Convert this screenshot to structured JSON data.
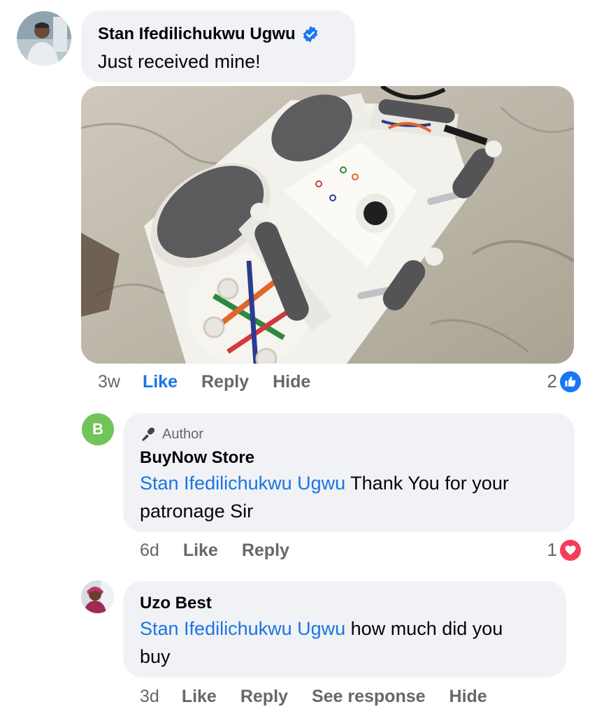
{
  "comments": [
    {
      "author": "Stan Ifedilichukwu Ugwu",
      "verified": true,
      "text": "Just received mine!",
      "has_photo": true,
      "time": "3w",
      "actions": [
        "Like",
        "Reply",
        "Hide"
      ],
      "liked": true,
      "reaction_count": "2",
      "reaction_type": "like",
      "reaction_color": "#1877f2"
    }
  ],
  "replies": [
    {
      "badge": "Author",
      "author": "BuyNow Store",
      "avatar_letter": "B",
      "avatar_color": "#71c45a",
      "mention": "Stan Ifedilichukwu Ugwu",
      "text_line1": " Thank You for your",
      "text_line2": "patronage Sir",
      "time": "6d",
      "actions": [
        "Like",
        "Reply"
      ],
      "reaction_count": "1",
      "reaction_type": "love",
      "reaction_color": "#f33e58"
    },
    {
      "author": "Uzo Best",
      "mention": "Stan Ifedilichukwu Ugwu",
      "text_line1": " how much did you",
      "text_line2": "buy",
      "time": "3d",
      "actions": [
        "Like",
        "Reply",
        "See response",
        "Hide"
      ]
    }
  ],
  "colors": {
    "link": "#1b74e4",
    "bubble": "#f0f2f5",
    "muted": "#65676b"
  }
}
